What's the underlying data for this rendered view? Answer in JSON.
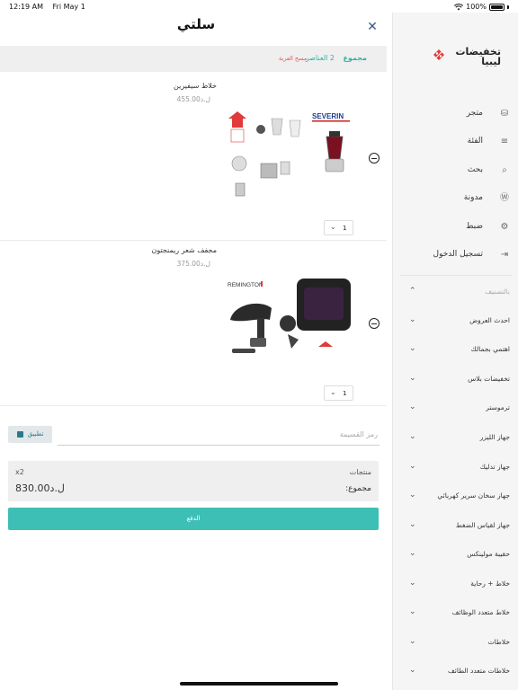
{
  "status_bar": {
    "time": "12:19 AM",
    "date": "Fri May 1",
    "battery": "100%"
  },
  "sidebar": {
    "logo_text": "تخفيضات ليبيا",
    "menu": [
      {
        "label": "متجر",
        "icon": "basket-icon"
      },
      {
        "label": "الفئة",
        "icon": "list-icon"
      },
      {
        "label": "بحث",
        "icon": "search-icon"
      },
      {
        "label": "مدونة",
        "icon": "wordpress-icon"
      },
      {
        "label": "ضبط",
        "icon": "gear-icon"
      },
      {
        "label": "تسجيل الدخول",
        "icon": "login-icon"
      }
    ],
    "categories_header": "بالتصنيف",
    "categories": [
      "احدث العروض",
      "اهتمي بجمالك",
      "تخفيضات بلاس",
      "ترموستر",
      "جهاز الليزر",
      "جهاز تدليك",
      "جهاز سخان سرير كهربائي",
      "جهاز لقياس الضغط",
      "حقيبة مولينكس",
      "خلاط + رحاية",
      "خلاط متعدد الوظائف",
      "خلاطات",
      "خلاطات متعدد الطائف"
    ]
  },
  "cart": {
    "title": "سلتي",
    "summary_total_label": "مجموع",
    "summary_count": "2 العناصر",
    "clear_label": "مسح العربة",
    "items": [
      {
        "name": "خلاط سيفيرين",
        "price": "ل.د455.00",
        "qty": "1",
        "brand": "SEVERIN"
      },
      {
        "name": "مجفف شعر ريمنجتون",
        "price": "ل.د375.00",
        "qty": "1",
        "brand": "REMINGTON"
      }
    ],
    "coupon_placeholder": "رمز القسيمة",
    "apply_label": "تطبيق",
    "products_label": "منتجات",
    "qty_label": "x2",
    "sum_label": "مجموع:",
    "sum_value": "ل.د830.00",
    "pay_label": "الدفع"
  },
  "colors": {
    "accent": "#3dbfb6",
    "brand_red": "#e03a3a",
    "clear_red": "#e05656"
  }
}
